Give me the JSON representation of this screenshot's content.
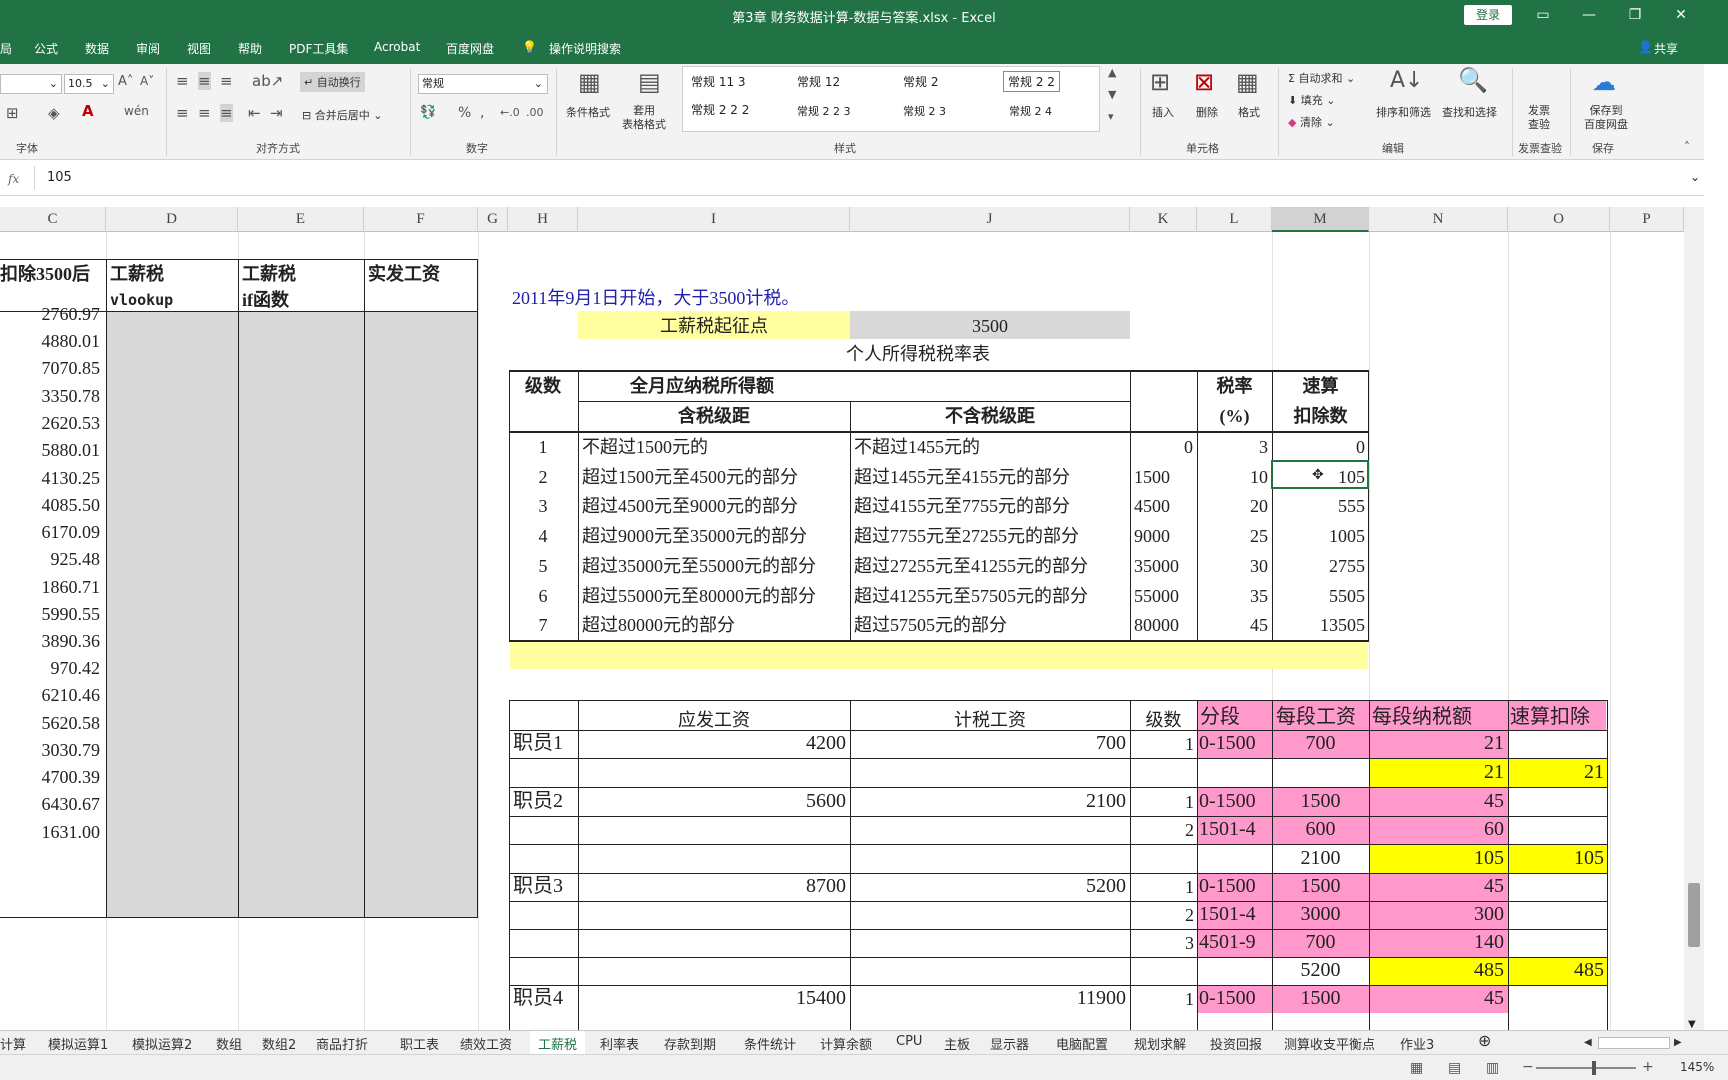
{
  "window": {
    "title": "第3章 财务数据计算-数据与答案.xlsx  -  Excel",
    "login": "登录"
  },
  "menu": {
    "items": [
      "局",
      "公式",
      "数据",
      "审阅",
      "视图",
      "帮助",
      "PDF工具集",
      "Acrobat",
      "百度网盘"
    ],
    "tell_me": "操作说明搜索",
    "share": "共享"
  },
  "ribbon": {
    "font_size": "10.5",
    "wrap_text": "自动换行",
    "merge_center": "合并后居中",
    "number_format": "常规",
    "groups": {
      "font": "字体",
      "align": "对齐方式",
      "number": "数字",
      "styles": "样式",
      "cells": "单元格",
      "edit": "编辑",
      "invoice": "发票查验",
      "save": "保存"
    },
    "cond_format": "条件格式",
    "table_format": "套用\n表格格式",
    "styles": [
      "常规 11 3",
      "常规 12",
      "常规 2",
      "常规 2 2",
      "常规 2 2 2",
      "常规 2 2 3",
      "常规 2 3",
      "常规 2 4"
    ],
    "insert": "插入",
    "delete": "删除",
    "format": "格式",
    "autosum": "自动求和",
    "fill": "填充",
    "clear": "清除",
    "sort_filter": "排序和筛选",
    "find_select": "查找和选择",
    "invoice_btn": "发票\n查验",
    "save_baidu": "保存到\n百度网盘"
  },
  "formula_bar": {
    "fx": "fx",
    "value": "105"
  },
  "columns": [
    "C",
    "D",
    "E",
    "F",
    "G",
    "H",
    "I",
    "J",
    "K",
    "L",
    "M",
    "N",
    "O",
    "P"
  ],
  "left_table": {
    "headers": {
      "c": "扣除3500后",
      "d1": "工薪税",
      "d2": "vlookup",
      "e1": "工薪税",
      "e2": "if函数",
      "f": "实发工资"
    },
    "values": [
      "2760.97",
      "4880.01",
      "7070.85",
      "3350.78",
      "2620.53",
      "5880.01",
      "4130.25",
      "4085.50",
      "6170.09",
      "925.48",
      "1860.71",
      "5990.55",
      "3890.36",
      "970.42",
      "6210.46",
      "5620.58",
      "3030.79",
      "4700.39",
      "6430.67",
      "1631.00"
    ]
  },
  "note": "2011年9月1日开始，大于3500计税。",
  "threshold": {
    "label": "工薪税起征点",
    "value": "3500"
  },
  "rate_table": {
    "title": "个人所得税税率表",
    "h_level": "级数",
    "h_income": "全月应纳税所得额",
    "h_with_tax": "含税级距",
    "h_without_tax": "不含税级距",
    "h_rate1": "税率",
    "h_rate2": "(%)",
    "h_quick1": "速算",
    "h_quick2": "扣除数",
    "rows": [
      {
        "level": "1",
        "with": "不超过1500元的",
        "without": "不超过1455元的",
        "k": "0",
        "rate": "3",
        "quick": "0"
      },
      {
        "level": "2",
        "with": "超过1500元至4500元的部分",
        "without": "超过1455元至4155元的部分",
        "k": "1500",
        "rate": "10",
        "quick": "105"
      },
      {
        "level": "3",
        "with": "超过4500元至9000元的部分",
        "without": "超过4155元至7755元的部分",
        "k": "4500",
        "rate": "20",
        "quick": "555"
      },
      {
        "level": "4",
        "with": "超过9000元至35000元的部分",
        "without": "超过7755元至27255元的部分",
        "k": "9000",
        "rate": "25",
        "quick": "1005"
      },
      {
        "level": "5",
        "with": "超过35000元至55000元的部分",
        "without": "超过27255元至41255元的部分",
        "k": "35000",
        "rate": "30",
        "quick": "2755"
      },
      {
        "level": "6",
        "with": "超过55000元至80000元的部分",
        "without": "超过41255元至57505元的部分",
        "k": "55000",
        "rate": "35",
        "quick": "5505"
      },
      {
        "level": "7",
        "with": "超过80000元的部分",
        "without": "超过57505元的部分",
        "k": "80000",
        "rate": "45",
        "quick": "13505"
      }
    ]
  },
  "emp_table": {
    "headers": {
      "i": "应发工资",
      "j": "计税工资",
      "k": "级数",
      "l": "分段",
      "m": "每段工资",
      "n": "每段纳税额",
      "o": "速算扣除"
    },
    "employees": [
      {
        "name": "职员1",
        "gross": "4200",
        "taxable": "700"
      },
      {
        "name": "职员2",
        "gross": "5600",
        "taxable": "2100"
      },
      {
        "name": "职员3",
        "gross": "8700",
        "taxable": "5200"
      },
      {
        "name": "职员4",
        "gross": "15400",
        "taxable": "11900"
      }
    ],
    "seg_rows": [
      {
        "k": "1",
        "l": "0-1500",
        "m": "700",
        "n": "21",
        "o": ""
      },
      {
        "k": "",
        "l": "",
        "m": "",
        "n": "21",
        "o": "21"
      },
      {
        "k": "1",
        "l": "0-1500",
        "m": "1500",
        "n": "45",
        "o": ""
      },
      {
        "k": "2",
        "l": "1501-4",
        "m": "600",
        "n": "60",
        "o": ""
      },
      {
        "k": "",
        "l": "",
        "m": "2100",
        "n": "105",
        "o": "105"
      },
      {
        "k": "1",
        "l": "0-1500",
        "m": "1500",
        "n": "45",
        "o": ""
      },
      {
        "k": "2",
        "l": "1501-4",
        "m": "3000",
        "n": "300",
        "o": ""
      },
      {
        "k": "3",
        "l": "4501-9",
        "m": "700",
        "n": "140",
        "o": ""
      },
      {
        "k": "",
        "l": "",
        "m": "5200",
        "n": "485",
        "o": "485"
      },
      {
        "k": "1",
        "l": "0-1500",
        "m": "1500",
        "n": "45",
        "o": ""
      }
    ]
  },
  "tabs": [
    "计算",
    "模拟运算1",
    "模拟运算2",
    "数组",
    "数组2",
    "商品打折",
    "职工表",
    "绩效工资",
    "工薪税",
    "利率表",
    "存款到期",
    "条件统计",
    "计算余额",
    "CPU",
    "主板",
    "显示器",
    "电脑配置",
    "规划求解",
    "投资回报",
    "测算收支平衡点",
    "作业3"
  ],
  "active_tab": "工薪税",
  "status": {
    "zoom": "145%"
  },
  "colors": {
    "excel_green": "#217346",
    "pink": "#ff99cc",
    "yellow": "#ffff00",
    "light_yellow": "#ffff9f",
    "gray_fill": "#d9d9d9",
    "note_blue": "#1f1faa"
  }
}
